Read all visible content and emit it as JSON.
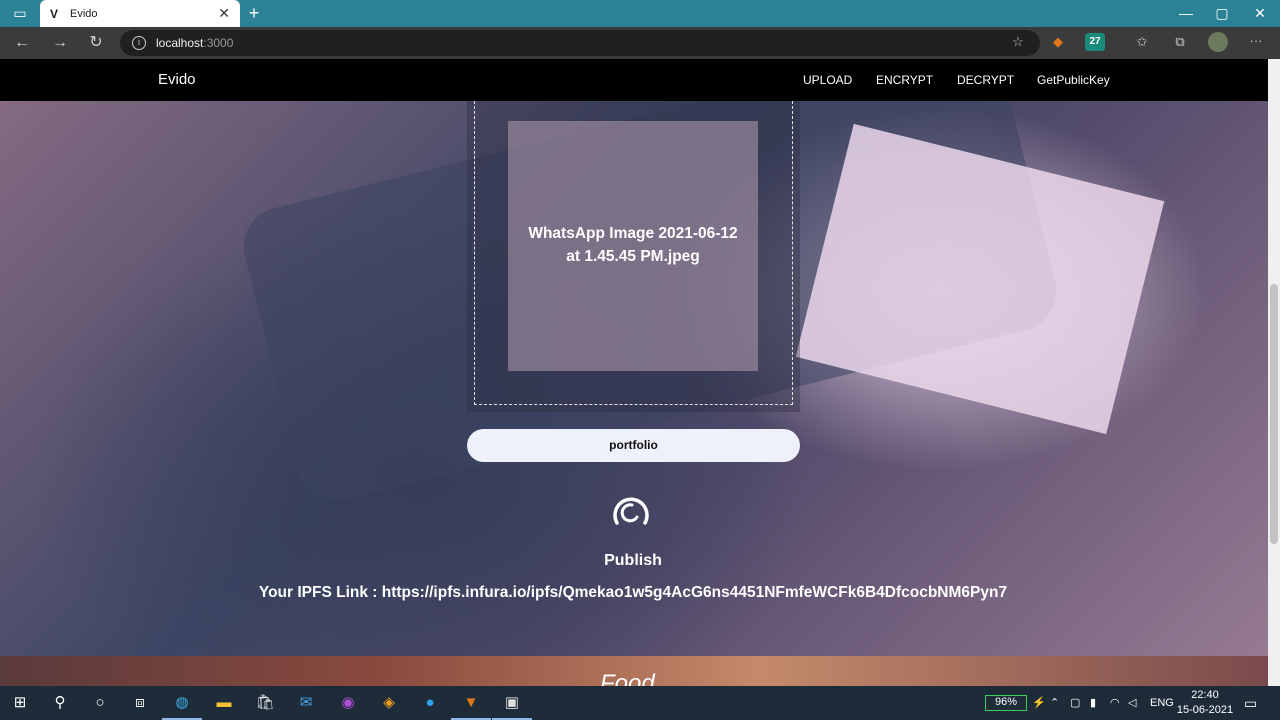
{
  "browser": {
    "tab_title": "Evido",
    "tab_favicon": "V",
    "address_host": "localhost",
    "address_port": ":3000",
    "extension_badge": "27"
  },
  "site": {
    "brand": "Evido",
    "nav": [
      "UPLOAD",
      "ENCRYPT",
      "DECRYPT",
      "GetPublicKey"
    ]
  },
  "upload": {
    "file_name_line1": "WhatsApp Image 2021-06-12",
    "file_name_line2": "at 1.45.45 PM.jpeg",
    "input_value": "portfolio",
    "publish_label": "Publish",
    "ipfs_link": "Your IPFS Link : https://ipfs.infura.io/ipfs/Qmekao1w5g4AcG6ns4451NFmfeWCFk6B4DfcocbNM6Pyn7"
  },
  "next_section": {
    "title": "Food"
  },
  "taskbar": {
    "battery": "96%",
    "language": "ENG",
    "time": "22:40",
    "date": "15-06-2021"
  },
  "colors": {
    "titlebar": "#2b8196",
    "navbar": "#000000",
    "taskbar": "#1e2c3a",
    "battery": "#3ecf5a"
  }
}
